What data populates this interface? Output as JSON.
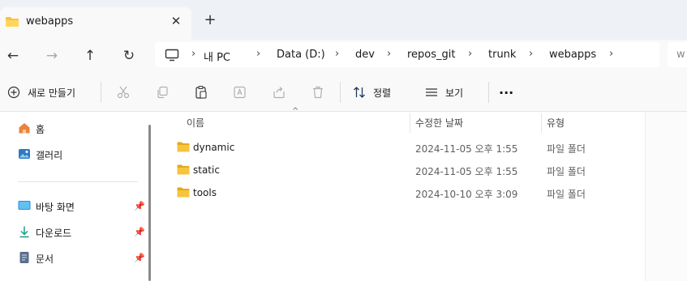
{
  "tab": {
    "title": "webapps",
    "close_icon": "close-icon",
    "new_tab": "+"
  },
  "nav": {
    "breadcrumbs": [
      "내 PC",
      "Data (D:)",
      "dev",
      "repos_git",
      "trunk",
      "webapps"
    ],
    "search_placeholder": "w"
  },
  "toolbar": {
    "new_label": "새로 만들기",
    "sort_label": "정렬",
    "view_label": "보기",
    "more_label": "···"
  },
  "sidebar": {
    "items": [
      {
        "label": "홈",
        "icon": "home-icon"
      },
      {
        "label": "갤러리",
        "icon": "gallery-icon"
      },
      {
        "label": "바탕 화면",
        "icon": "desktop-icon",
        "pinned": true
      },
      {
        "label": "다운로드",
        "icon": "download-icon",
        "pinned": true
      },
      {
        "label": "문서",
        "icon": "document-icon",
        "pinned": true
      }
    ]
  },
  "columns": {
    "name": "이름",
    "date": "수정한 날짜",
    "type": "유형"
  },
  "files": [
    {
      "name": "dynamic",
      "date": "2024-11-05 오후 1:55",
      "type": "파일 폴더"
    },
    {
      "name": "static",
      "date": "2024-11-05 오후 1:55",
      "type": "파일 폴더"
    },
    {
      "name": "tools",
      "date": "2024-10-10 오후 3:09",
      "type": "파일 폴더"
    }
  ],
  "colors": {
    "folder": "#f5c540",
    "folder_dark": "#e6a817",
    "accent": "#0067c0",
    "titlebar": "#eef2f6"
  }
}
